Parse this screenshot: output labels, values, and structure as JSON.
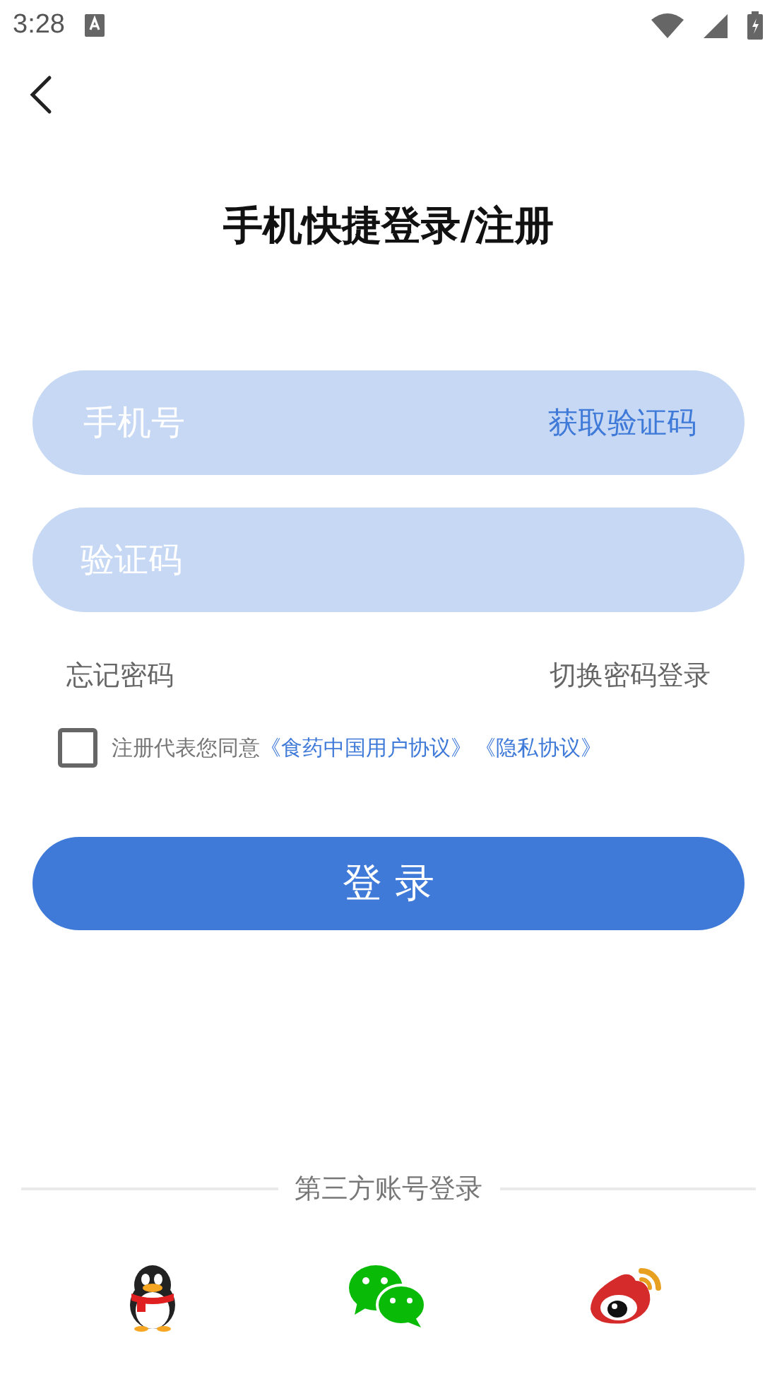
{
  "status_bar": {
    "time": "3:28"
  },
  "header": {
    "title": "手机快捷登录/注册"
  },
  "phone_field": {
    "placeholder": "手机号",
    "action": "获取验证码"
  },
  "code_field": {
    "placeholder": "验证码"
  },
  "links": {
    "left": "忘记密码",
    "right": "切换密码登录"
  },
  "agreement": {
    "checked": false,
    "text": "注册代表您同意",
    "links": [
      "《食药中国用户协议》",
      "《隐私协议》"
    ]
  },
  "login_button": "登 录",
  "third_party": {
    "label": "第三方账号登录",
    "providers": [
      {
        "kind": "qq"
      },
      {
        "kind": "wechat"
      },
      {
        "kind": "weibo"
      }
    ]
  }
}
